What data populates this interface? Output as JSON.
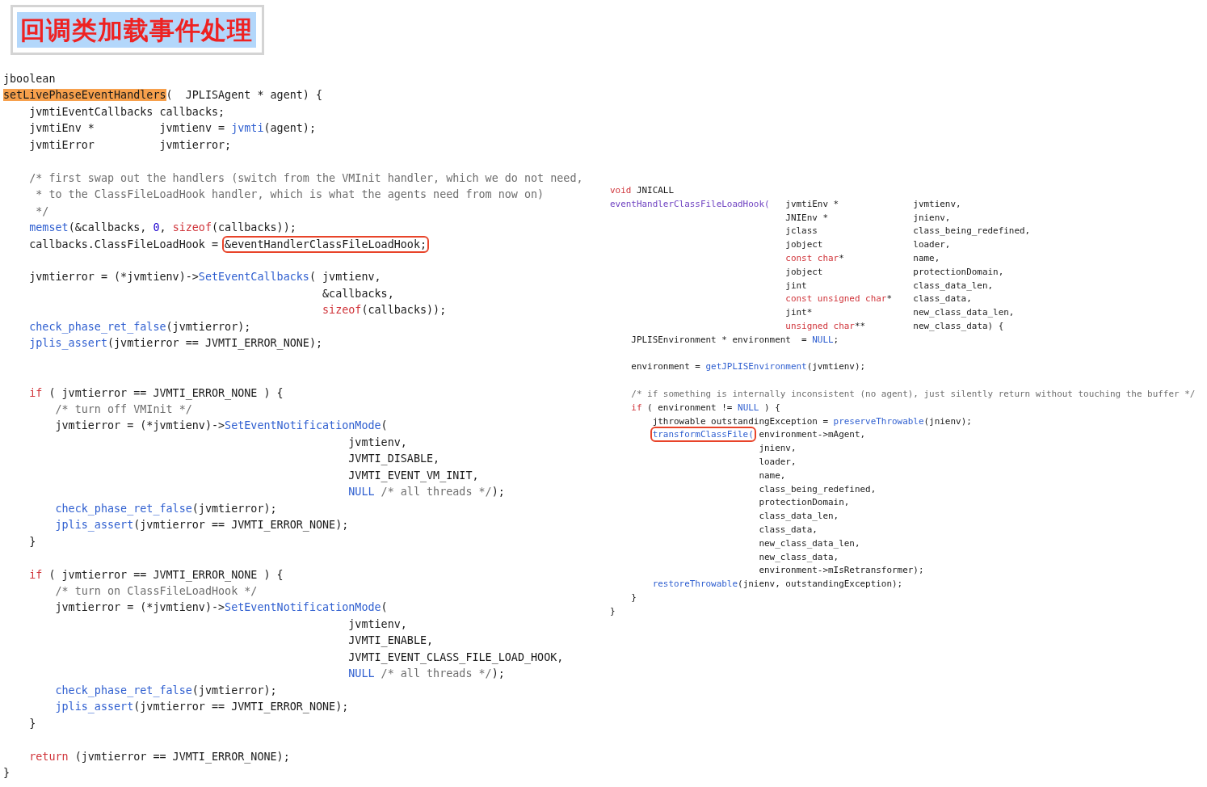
{
  "title": "回调类加载事件处理",
  "left_code": [
    {
      "kind": "code",
      "tokens": [
        {
          "text": "jboolean",
          "kind": "plain"
        }
      ]
    },
    {
      "kind": "code",
      "tokens": [
        {
          "text": "setLivePhaseEventHandlers",
          "kind": "marked"
        },
        {
          "text": "(  JPLISAgent * agent) {",
          "kind": "plain"
        }
      ]
    },
    {
      "kind": "code",
      "tokens": [
        {
          "text": "    jvmtiEventCallbacks callbacks;",
          "kind": "plain"
        }
      ]
    },
    {
      "kind": "code",
      "tokens": [
        {
          "text": "    jvmtiEnv *          jvmtienv = ",
          "kind": "plain"
        },
        {
          "text": "jvmti",
          "kind": "call"
        },
        {
          "text": "(agent);",
          "kind": "plain"
        }
      ]
    },
    {
      "kind": "code",
      "tokens": [
        {
          "text": "    jvmtiError          jvmtierror;",
          "kind": "plain"
        }
      ]
    },
    {
      "kind": "gap",
      "tokens": [
        {
          "text": "    /* first swap out the handlers (switch from the VMInit handler, which we do not need,",
          "kind": "comment"
        }
      ]
    },
    {
      "kind": "code",
      "tokens": [
        {
          "text": "     * to the ClassFileLoadHook handler, which is what the agents need from now on)",
          "kind": "comment"
        }
      ]
    },
    {
      "kind": "code",
      "tokens": [
        {
          "text": "     */",
          "kind": "comment"
        }
      ]
    },
    {
      "kind": "code",
      "tokens": [
        {
          "text": "    memset",
          "kind": "call"
        },
        {
          "text": "(&callbacks, ",
          "kind": "plain"
        },
        {
          "text": "0",
          "kind": "number"
        },
        {
          "text": ", ",
          "kind": "plain"
        },
        {
          "text": "sizeof",
          "kind": "keyword"
        },
        {
          "text": "(callbacks));",
          "kind": "plain"
        }
      ]
    },
    {
      "kind": "code",
      "tokens": [
        {
          "text": "    callbacks.ClassFileLoadHook = ",
          "kind": "plain"
        },
        {
          "text": "&eventHandlerClassFileLoadHook;",
          "kind": "boxed"
        }
      ]
    },
    {
      "kind": "gap",
      "tokens": [
        {
          "text": "    jvmtierror = (*jvmtienv)->",
          "kind": "plain"
        },
        {
          "text": "SetEventCallbacks",
          "kind": "call"
        },
        {
          "text": "( jvmtienv,",
          "kind": "plain"
        }
      ]
    },
    {
      "kind": "code",
      "tokens": [
        {
          "text": "                                                 &callbacks,",
          "kind": "plain"
        }
      ]
    },
    {
      "kind": "code",
      "tokens": [
        {
          "text": "                                                 sizeof",
          "kind": "keyword"
        },
        {
          "text": "(callbacks));",
          "kind": "plain"
        }
      ]
    },
    {
      "kind": "code",
      "tokens": [
        {
          "text": "    check_phase_ret_false",
          "kind": "call"
        },
        {
          "text": "(jvmtierror);",
          "kind": "plain"
        }
      ]
    },
    {
      "kind": "code",
      "tokens": [
        {
          "text": "    jplis_assert",
          "kind": "call"
        },
        {
          "text": "(jvmtierror == JVMTI_ERROR_NONE);",
          "kind": "plain"
        }
      ]
    },
    {
      "kind": "gap2",
      "tokens": [
        {
          "text": "    if",
          "kind": "keyword"
        },
        {
          "text": " ( jvmtierror == JVMTI_ERROR_NONE ) {",
          "kind": "plain"
        }
      ]
    },
    {
      "kind": "code",
      "tokens": [
        {
          "text": "        /* turn off VMInit */",
          "kind": "comment"
        }
      ]
    },
    {
      "kind": "code",
      "tokens": [
        {
          "text": "        jvmtierror = (*jvmtienv)->",
          "kind": "plain"
        },
        {
          "text": "SetEventNotificationMode",
          "kind": "call"
        },
        {
          "text": "(",
          "kind": "plain"
        }
      ]
    },
    {
      "kind": "code",
      "tokens": [
        {
          "text": "                                                     jvmtienv,",
          "kind": "plain"
        }
      ]
    },
    {
      "kind": "code",
      "tokens": [
        {
          "text": "                                                     JVMTI_DISABLE,",
          "kind": "plain"
        }
      ]
    },
    {
      "kind": "code",
      "tokens": [
        {
          "text": "                                                     JVMTI_EVENT_VM_INIT,",
          "kind": "plain"
        }
      ]
    },
    {
      "kind": "code",
      "tokens": [
        {
          "text": "                                                     NULL",
          "kind": "call"
        },
        {
          "text": " /* all threads */",
          "kind": "comment"
        },
        {
          "text": ");",
          "kind": "plain"
        }
      ]
    },
    {
      "kind": "code",
      "tokens": [
        {
          "text": "        check_phase_ret_false",
          "kind": "call"
        },
        {
          "text": "(jvmtierror);",
          "kind": "plain"
        }
      ]
    },
    {
      "kind": "code",
      "tokens": [
        {
          "text": "        jplis_assert",
          "kind": "call"
        },
        {
          "text": "(jvmtierror == JVMTI_ERROR_NONE);",
          "kind": "plain"
        }
      ]
    },
    {
      "kind": "code",
      "tokens": [
        {
          "text": "    }",
          "kind": "plain"
        }
      ]
    },
    {
      "kind": "gap",
      "tokens": [
        {
          "text": "    if",
          "kind": "keyword"
        },
        {
          "text": " ( jvmtierror == JVMTI_ERROR_NONE ) {",
          "kind": "plain"
        }
      ]
    },
    {
      "kind": "code",
      "tokens": [
        {
          "text": "        /* turn on ClassFileLoadHook */",
          "kind": "comment"
        }
      ]
    },
    {
      "kind": "code",
      "tokens": [
        {
          "text": "        jvmtierror = (*jvmtienv)->",
          "kind": "plain"
        },
        {
          "text": "SetEventNotificationMode",
          "kind": "call"
        },
        {
          "text": "(",
          "kind": "plain"
        }
      ]
    },
    {
      "kind": "code",
      "tokens": [
        {
          "text": "                                                     jvmtienv,",
          "kind": "plain"
        }
      ]
    },
    {
      "kind": "code",
      "tokens": [
        {
          "text": "                                                     JVMTI_ENABLE,",
          "kind": "plain"
        }
      ]
    },
    {
      "kind": "code",
      "tokens": [
        {
          "text": "                                                     JVMTI_EVENT_CLASS_FILE_LOAD_HOOK,",
          "kind": "plain"
        }
      ]
    },
    {
      "kind": "code",
      "tokens": [
        {
          "text": "                                                     NULL",
          "kind": "call"
        },
        {
          "text": " /* all threads */",
          "kind": "comment"
        },
        {
          "text": ");",
          "kind": "plain"
        }
      ]
    },
    {
      "kind": "code",
      "tokens": [
        {
          "text": "        check_phase_ret_false",
          "kind": "call"
        },
        {
          "text": "(jvmtierror);",
          "kind": "plain"
        }
      ]
    },
    {
      "kind": "code",
      "tokens": [
        {
          "text": "        jplis_assert",
          "kind": "call"
        },
        {
          "text": "(jvmtierror == JVMTI_ERROR_NONE);",
          "kind": "plain"
        }
      ]
    },
    {
      "kind": "code",
      "tokens": [
        {
          "text": "    }",
          "kind": "plain"
        }
      ]
    },
    {
      "kind": "gap",
      "tokens": [
        {
          "text": "    return",
          "kind": "keyword"
        },
        {
          "text": " (jvmtierror == JVMTI_ERROR_NONE);",
          "kind": "plain"
        }
      ]
    },
    {
      "kind": "code",
      "tokens": [
        {
          "text": "}",
          "kind": "plain"
        }
      ]
    }
  ],
  "right_code": [
    {
      "kind": "code",
      "tokens": [
        {
          "text": "void",
          "kind": "keyword"
        },
        {
          "text": " JNICALL",
          "kind": "plain"
        }
      ]
    },
    {
      "kind": "code",
      "tokens": [
        {
          "text": "eventHandlerClassFileLoadHook(",
          "kind": "decl"
        },
        {
          "text": "   jvmtiEnv *              jvmtienv,",
          "kind": "plain"
        }
      ]
    },
    {
      "kind": "code",
      "tokens": [
        {
          "text": "                                 JNIEnv *                jnienv,",
          "kind": "plain"
        }
      ]
    },
    {
      "kind": "code",
      "tokens": [
        {
          "text": "                                 jclass                  class_being_redefined,",
          "kind": "plain"
        }
      ]
    },
    {
      "kind": "code",
      "tokens": [
        {
          "text": "                                 jobject                 loader,",
          "kind": "plain"
        }
      ]
    },
    {
      "kind": "code",
      "tokens": [
        {
          "text": "                                 const char",
          "kind": "keyword"
        },
        {
          "text": "*             name,",
          "kind": "plain"
        }
      ]
    },
    {
      "kind": "code",
      "tokens": [
        {
          "text": "                                 jobject                 protectionDomain,",
          "kind": "plain"
        }
      ]
    },
    {
      "kind": "code",
      "tokens": [
        {
          "text": "                                 jint                    class_data_len,",
          "kind": "plain"
        }
      ]
    },
    {
      "kind": "code",
      "tokens": [
        {
          "text": "                                 const unsigned char",
          "kind": "keyword"
        },
        {
          "text": "*    class_data,",
          "kind": "plain"
        }
      ]
    },
    {
      "kind": "code",
      "tokens": [
        {
          "text": "                                 jint*                   new_class_data_len,",
          "kind": "plain"
        }
      ]
    },
    {
      "kind": "code",
      "tokens": [
        {
          "text": "                                 unsigned char",
          "kind": "keyword"
        },
        {
          "text": "**         new_class_data) {",
          "kind": "plain"
        }
      ]
    },
    {
      "kind": "code",
      "tokens": [
        {
          "text": "    JPLISEnvironment * environment  = ",
          "kind": "plain"
        },
        {
          "text": "NULL",
          "kind": "call"
        },
        {
          "text": ";",
          "kind": "plain"
        }
      ]
    },
    {
      "kind": "gap",
      "tokens": [
        {
          "text": "    environment = ",
          "kind": "plain"
        },
        {
          "text": "getJPLISEnvironment",
          "kind": "call"
        },
        {
          "text": "(jvmtienv);",
          "kind": "plain"
        }
      ]
    },
    {
      "kind": "gap",
      "tokens": [
        {
          "text": "    /* if something is internally inconsistent (no agent), just silently return without touching the buffer */",
          "kind": "comment"
        }
      ]
    },
    {
      "kind": "code",
      "tokens": [
        {
          "text": "    if",
          "kind": "keyword"
        },
        {
          "text": " ( environment != ",
          "kind": "plain"
        },
        {
          "text": "NULL",
          "kind": "call"
        },
        {
          "text": " ) {",
          "kind": "plain"
        }
      ]
    },
    {
      "kind": "code",
      "tokens": [
        {
          "text": "        jthrowable outstandingException = ",
          "kind": "plain"
        },
        {
          "text": "preserveThrowable",
          "kind": "call"
        },
        {
          "text": "(jnienv);",
          "kind": "plain"
        }
      ]
    },
    {
      "kind": "code",
      "tokens": [
        {
          "text": "transformClassFile(",
          "kind": "boxed_call"
        },
        {
          "text": " environment->mAgent,",
          "kind": "plain"
        }
      ]
    },
    {
      "kind": "code",
      "tokens": [
        {
          "text": "                            jnienv,",
          "kind": "plain"
        }
      ]
    },
    {
      "kind": "code",
      "tokens": [
        {
          "text": "                            loader,",
          "kind": "plain"
        }
      ]
    },
    {
      "kind": "code",
      "tokens": [
        {
          "text": "                            name,",
          "kind": "plain"
        }
      ]
    },
    {
      "kind": "code",
      "tokens": [
        {
          "text": "                            class_being_redefined,",
          "kind": "plain"
        }
      ]
    },
    {
      "kind": "code",
      "tokens": [
        {
          "text": "                            protectionDomain,",
          "kind": "plain"
        }
      ]
    },
    {
      "kind": "code",
      "tokens": [
        {
          "text": "                            class_data_len,",
          "kind": "plain"
        }
      ]
    },
    {
      "kind": "code",
      "tokens": [
        {
          "text": "                            class_data,",
          "kind": "plain"
        }
      ]
    },
    {
      "kind": "code",
      "tokens": [
        {
          "text": "                            new_class_data_len,",
          "kind": "plain"
        }
      ]
    },
    {
      "kind": "code",
      "tokens": [
        {
          "text": "                            new_class_data,",
          "kind": "plain"
        }
      ]
    },
    {
      "kind": "code",
      "tokens": [
        {
          "text": "                            environment->mIsRetransformer);",
          "kind": "plain"
        }
      ]
    },
    {
      "kind": "code",
      "tokens": [
        {
          "text": "        restoreThrowable",
          "kind": "call"
        },
        {
          "text": "(jnienv, outstandingException);",
          "kind": "plain"
        }
      ]
    },
    {
      "kind": "code",
      "tokens": [
        {
          "text": "    }",
          "kind": "plain"
        }
      ]
    },
    {
      "kind": "code",
      "tokens": [
        {
          "text": "}",
          "kind": "plain"
        }
      ]
    }
  ]
}
